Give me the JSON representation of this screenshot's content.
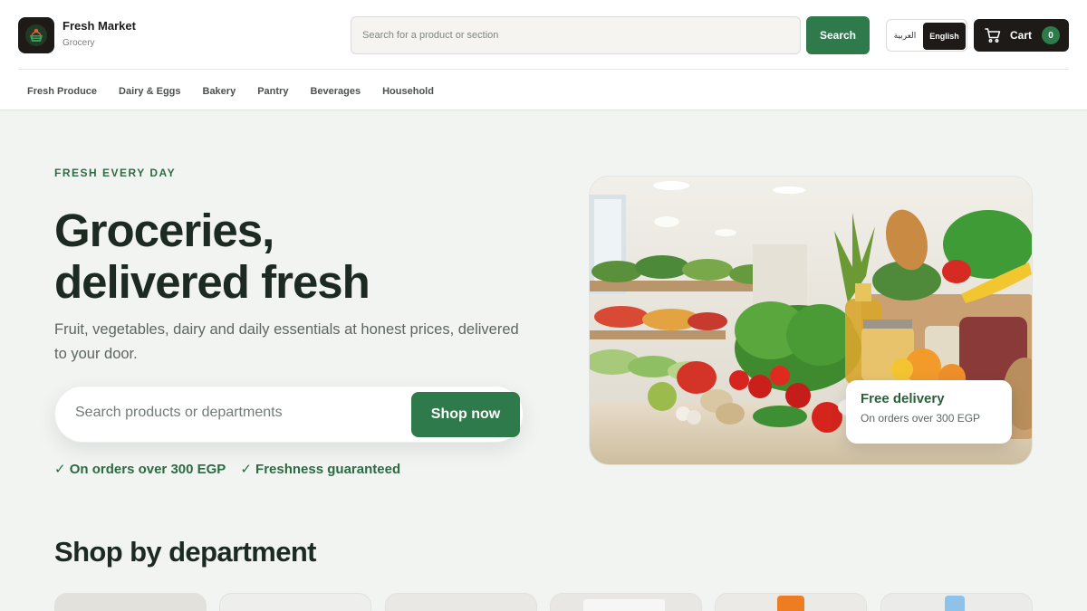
{
  "brand": {
    "name": "Fresh Market",
    "subtitle": "Grocery"
  },
  "header_search": {
    "placeholder": "Search for a product or section",
    "button_label": "Search"
  },
  "language": {
    "arabic": "العربية",
    "english": "English",
    "selected": "English"
  },
  "cart": {
    "label": "Cart",
    "count": "0"
  },
  "nav": {
    "items": [
      "Fresh Produce",
      "Dairy & Eggs",
      "Bakery",
      "Pantry",
      "Beverages",
      "Household"
    ]
  },
  "hero": {
    "eyebrow": "FRESH EVERY DAY",
    "title_line1": "Groceries,",
    "title_line2": "delivered fresh",
    "subtitle": "Fruit, vegetables, dairy and daily essentials at honest prices, delivered to your door.",
    "search_placeholder": "Search products or departments",
    "cta_label": "Shop now",
    "perks": [
      "✓ On orders over 300 EGP",
      "✓ Freshness guaranteed"
    ],
    "delivery_card": {
      "title": "Free delivery",
      "subtitle": "On orders over 300 EGP"
    }
  },
  "departments": {
    "title": "Shop by department",
    "card_count": 6
  },
  "colors": {
    "accent": "#2e7a4a",
    "dark": "#1d1a17",
    "background": "#f2f4f2",
    "eyebrow": "#2e6b43"
  }
}
